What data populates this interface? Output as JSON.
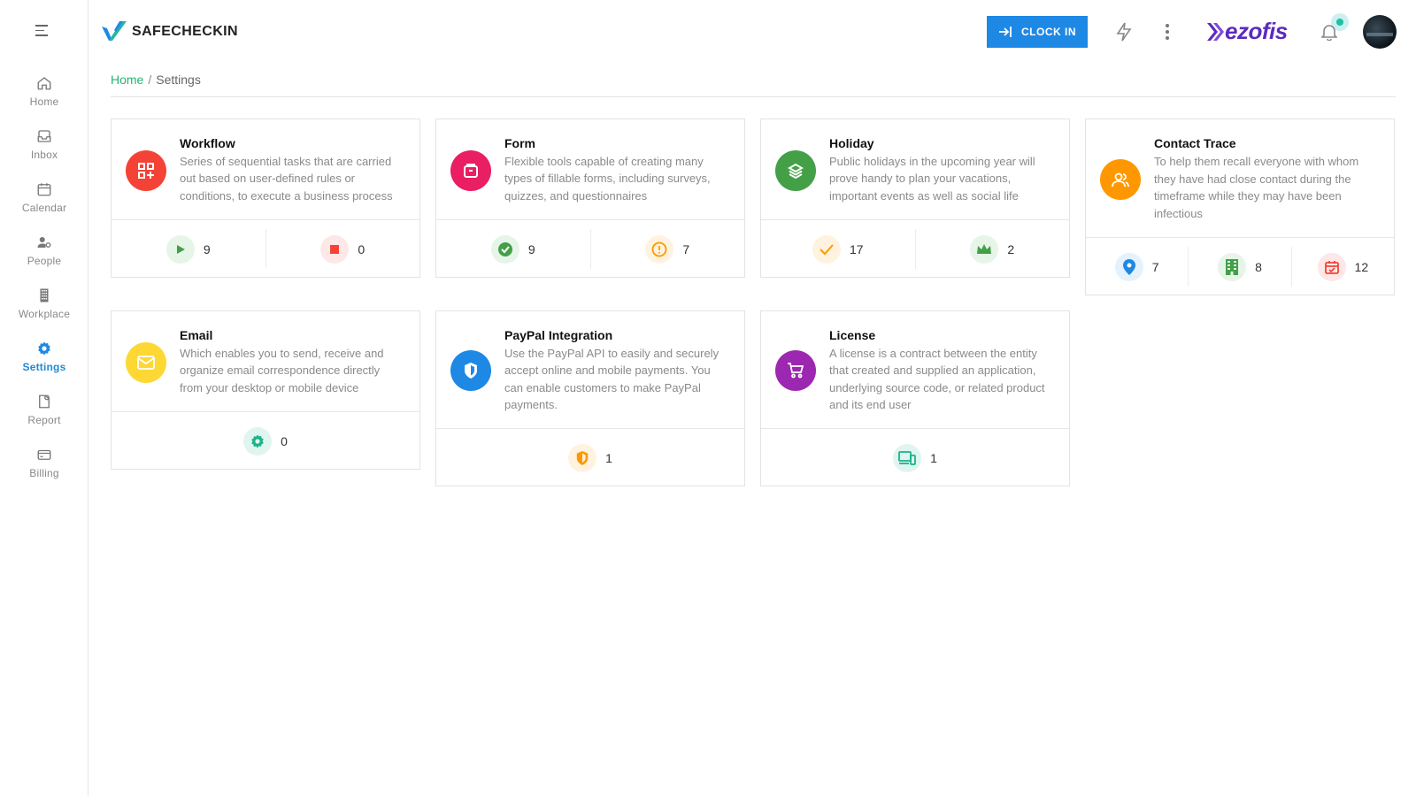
{
  "app": {
    "logo_text": "SAFECHECKIN",
    "brand": "ezofis",
    "clock_in_label": "CLOCK IN"
  },
  "sidebar": {
    "items": [
      {
        "label": "Home",
        "icon": "home-icon"
      },
      {
        "label": "Inbox",
        "icon": "inbox-icon"
      },
      {
        "label": "Calendar",
        "icon": "calendar-icon"
      },
      {
        "label": "People",
        "icon": "people-icon"
      },
      {
        "label": "Workplace",
        "icon": "building-icon"
      },
      {
        "label": "Settings",
        "icon": "gear-icon",
        "active": true
      },
      {
        "label": "Report",
        "icon": "report-icon"
      },
      {
        "label": "Billing",
        "icon": "billing-icon"
      }
    ]
  },
  "breadcrumb": {
    "home": "Home",
    "separator": "/",
    "current": "Settings"
  },
  "colors": {
    "accent": "#1e88e5",
    "green_link": "#22b573",
    "workflow": "#f44336",
    "form": "#e91e63",
    "holiday": "#43a047",
    "contact_trace": "#ff9800",
    "email": "#fdd835",
    "paypal": "#1e88e5",
    "license": "#9c27b0"
  },
  "cards": [
    {
      "title": "Workflow",
      "description": "Series of sequential tasks that are carried out based on user-defined rules or conditions, to execute a business process",
      "icon": "workflow-grid-icon",
      "stats": [
        {
          "icon": "play-icon",
          "value": "9"
        },
        {
          "icon": "stop-icon",
          "value": "0"
        }
      ]
    },
    {
      "title": "Form",
      "description": "Flexible tools capable of creating many types of fillable forms, including surveys, quizzes, and questionnaires",
      "icon": "form-icon",
      "stats": [
        {
          "icon": "check-circle-icon",
          "value": "9"
        },
        {
          "icon": "alert-circle-icon",
          "value": "7"
        }
      ]
    },
    {
      "title": "Holiday",
      "description": "Public holidays in the upcoming year will prove handy to plan your vacations, important events as well as social life",
      "icon": "layers-icon",
      "stats": [
        {
          "icon": "check-icon",
          "value": "17"
        },
        {
          "icon": "crown-icon",
          "value": "2"
        }
      ]
    },
    {
      "title": "Contact Trace",
      "description": "To help them recall everyone with whom they have had close contact during the timeframe while they may have been infectious",
      "icon": "users-icon",
      "stats": [
        {
          "icon": "location-pin-icon",
          "value": "7"
        },
        {
          "icon": "building-icon",
          "value": "8"
        },
        {
          "icon": "calendar-check-icon",
          "value": "12"
        }
      ]
    },
    {
      "title": "Email",
      "description": "Which enables you to send, receive and organize email correspondence directly from your desktop or mobile device",
      "icon": "mail-icon",
      "stats": [
        {
          "icon": "gear-icon",
          "value": "0"
        }
      ]
    },
    {
      "title": "PayPal Integration",
      "description": "Use the PayPal API to easily and securely accept online and mobile payments. You can enable customers to make PayPal payments.",
      "icon": "shield-icon",
      "stats": [
        {
          "icon": "shield-icon",
          "value": "1"
        }
      ]
    },
    {
      "title": "License",
      "description": "A license is a contract between the entity that created and supplied an application, underlying source code, or related product and its end user",
      "icon": "cart-icon",
      "stats": [
        {
          "icon": "devices-icon",
          "value": "1"
        }
      ]
    }
  ]
}
